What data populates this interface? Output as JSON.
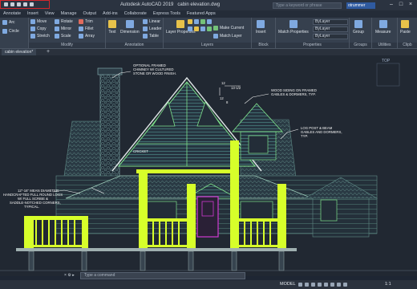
{
  "titlebar": {
    "app": "Autodesk AutoCAD 2019",
    "file": "cabin elevation.dwg",
    "search_placeholder": "Type a keyword or phrase",
    "user_label": "otrummer"
  },
  "tabs": [
    {
      "label": "Annotate"
    },
    {
      "label": "Insert"
    },
    {
      "label": "View"
    },
    {
      "label": "Manage"
    },
    {
      "label": "Output"
    },
    {
      "label": "Add-ins"
    },
    {
      "label": "Collaborate"
    },
    {
      "label": "Express Tools"
    },
    {
      "label": "Featured Apps"
    }
  ],
  "ribbon": {
    "draw": {
      "tools": [
        "Arc",
        "Circle"
      ]
    },
    "modify": {
      "label": "Modify",
      "tools": [
        "Move",
        "Rotate",
        "Trim",
        "Copy",
        "Mirror",
        "Fillet",
        "Stretch",
        "Scale",
        "Array"
      ]
    },
    "annotation": {
      "label": "Annotation",
      "tools": [
        "Text",
        "Dimension",
        "Linear",
        "Leader",
        "Table"
      ]
    },
    "layers": {
      "label": "Layers",
      "tools": [
        "Layer Properties",
        "Make Current",
        "Match Layer"
      ]
    },
    "block": {
      "label": "Block",
      "tools": [
        "Insert"
      ]
    },
    "properties": {
      "label": "Properties",
      "tools": [
        "Match Properties"
      ],
      "dropdowns": [
        "ByLayer",
        "ByLayer",
        "ByLayer"
      ]
    },
    "groups": {
      "label": "Groups",
      "tools": [
        "Group"
      ]
    },
    "utilities": {
      "label": "Utilities",
      "tools": [
        "Measure"
      ]
    },
    "clipboard": {
      "label": "Clipb",
      "tools": [
        "Paste"
      ]
    }
  },
  "file_tab": {
    "label": "cabin elevation*"
  },
  "drawing": {
    "annotations": {
      "chimney": [
        "OPTIONAL FRAMED",
        "CHIMNEY W/ CULTURED",
        "STONE OR WOOD FINISH."
      ],
      "siding": [
        "WOOD SIDING ON FRAMED",
        "GABLES & DORMERS, TYP."
      ],
      "log_post": [
        "LOG POST & BEAM",
        "GABLES AND DORMERS,",
        "TYP."
      ],
      "cricket": [
        "CRICKET"
      ],
      "logs": [
        "12\"-16\" MEAN DIAMETER",
        "HANDCRAFTED FULL ROUND LOGS",
        "W/ FULL SCRIBE &",
        "SADDLE-NOTCHED CORNERS,",
        "TYPICAL."
      ],
      "pitch_rise": "12",
      "pitch_run": "13-1/2",
      "pitch_rise2": "12",
      "pitch_run2": "8"
    },
    "colors": {
      "canvas": "#212832",
      "railing": "#d7ff2a",
      "roof_line": "#7ee08a",
      "walls": "#3f6f6a",
      "window": "#d13ad1",
      "text": "#f3f3f3"
    }
  },
  "command": {
    "placeholder": "Type a command"
  },
  "status": {
    "mode": "MODEL",
    "scale": "1:1"
  },
  "viewcube": {
    "label": "TOP"
  }
}
